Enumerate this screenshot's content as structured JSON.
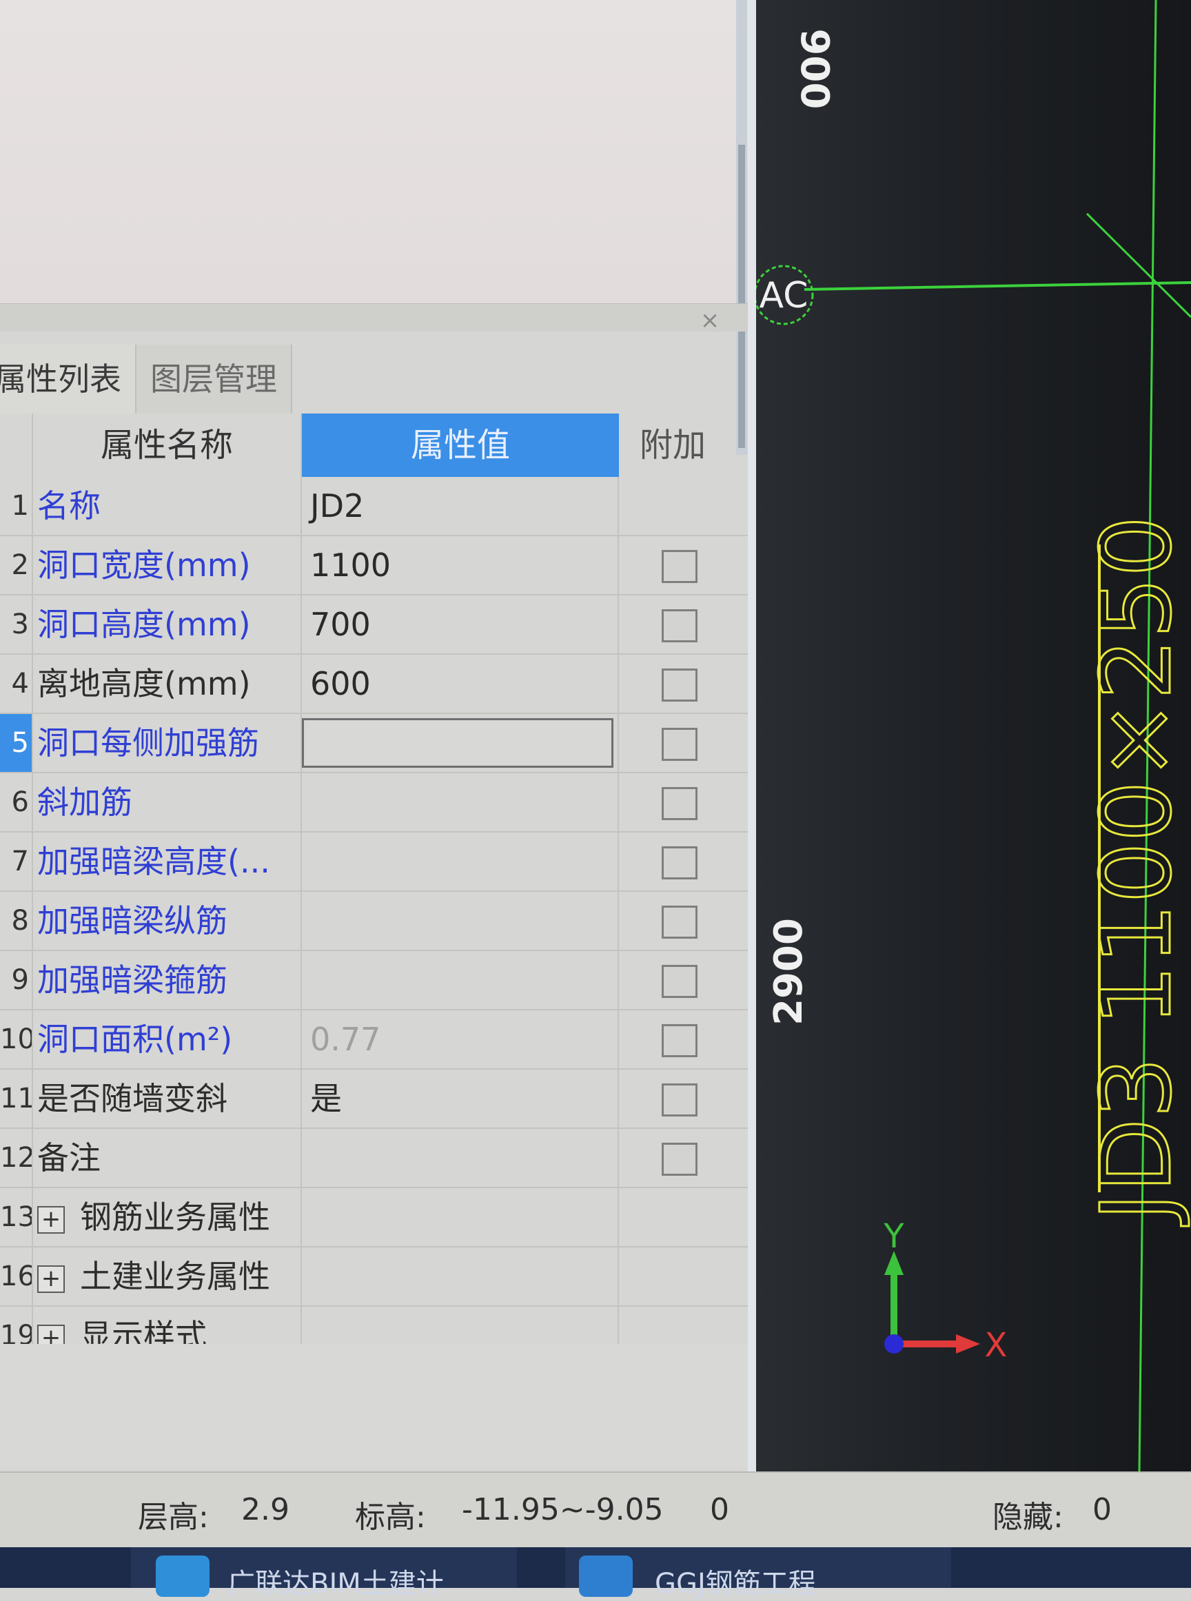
{
  "panel": {
    "close_icon": "×",
    "tabs": [
      {
        "label": "属性列表",
        "visible_label": "属性列表"
      },
      {
        "label": "图层管理"
      }
    ]
  },
  "table": {
    "headers": {
      "name": "属性名称",
      "value": "属性值",
      "extra": "附加"
    },
    "rows": [
      {
        "num": "1",
        "name": "名称",
        "value": "JD2",
        "blue": true,
        "checkbox": false
      },
      {
        "num": "2",
        "name": "洞口宽度(mm)",
        "value": "1100",
        "blue": true,
        "checkbox": true
      },
      {
        "num": "3",
        "name": "洞口高度(mm)",
        "value": "700",
        "blue": true,
        "checkbox": true
      },
      {
        "num": "4",
        "name": "离地高度(mm)",
        "value": "600",
        "blue": false,
        "checkbox": true
      },
      {
        "num": "5",
        "name": "洞口每侧加强筋",
        "value": "",
        "blue": true,
        "checkbox": true,
        "selected": true
      },
      {
        "num": "6",
        "name": "斜加筋",
        "value": "",
        "blue": true,
        "checkbox": true
      },
      {
        "num": "7",
        "name": "加强暗梁高度(...",
        "value": "",
        "blue": true,
        "checkbox": true
      },
      {
        "num": "8",
        "name": "加强暗梁纵筋",
        "value": "",
        "blue": true,
        "checkbox": true
      },
      {
        "num": "9",
        "name": "加强暗梁箍筋",
        "value": "",
        "blue": true,
        "checkbox": true
      },
      {
        "num": "10",
        "name": "洞口面积(m²)",
        "value": "0.77",
        "blue": true,
        "checkbox": true,
        "value_gray": true
      },
      {
        "num": "11",
        "name": "是否随墙变斜",
        "value": "是",
        "blue": false,
        "checkbox": true
      },
      {
        "num": "12",
        "name": "备注",
        "value": "",
        "blue": false,
        "checkbox": true
      },
      {
        "num": "13",
        "name": "钢筋业务属性",
        "value": "",
        "blue": false,
        "checkbox": false,
        "group": true
      },
      {
        "num": "16",
        "name": "土建业务属性",
        "value": "",
        "blue": false,
        "checkbox": false,
        "group": true
      },
      {
        "num": "19",
        "name": "显示样式",
        "value": "",
        "blue": false,
        "checkbox": false,
        "group": true
      }
    ]
  },
  "canvas": {
    "dim_top": "900",
    "dim_mid": "2900",
    "axis_label": "AC",
    "opening_label": "JD3 1100×250",
    "axis_y": "Y",
    "axis_x": "X",
    "colors": {
      "grid_line": "#3cd23c",
      "opening_text": "#e8e83c",
      "dim_text": "#f0f0f0",
      "x_axis": "#e03a3a",
      "y_axis": "#3cc23c",
      "origin": "#2b2bd6"
    }
  },
  "status": {
    "floor_height_label": "层高:",
    "floor_height_value": "2.9",
    "elevation_label": "标高:",
    "elevation_value": "-11.95~-9.05",
    "extra_value": "0",
    "hidden_label": "隐藏:",
    "hidden_value": "0"
  },
  "taskbar": {
    "item1_label": "广联达BIM土建计",
    "item2_label": "GGJ钢筋工程"
  }
}
